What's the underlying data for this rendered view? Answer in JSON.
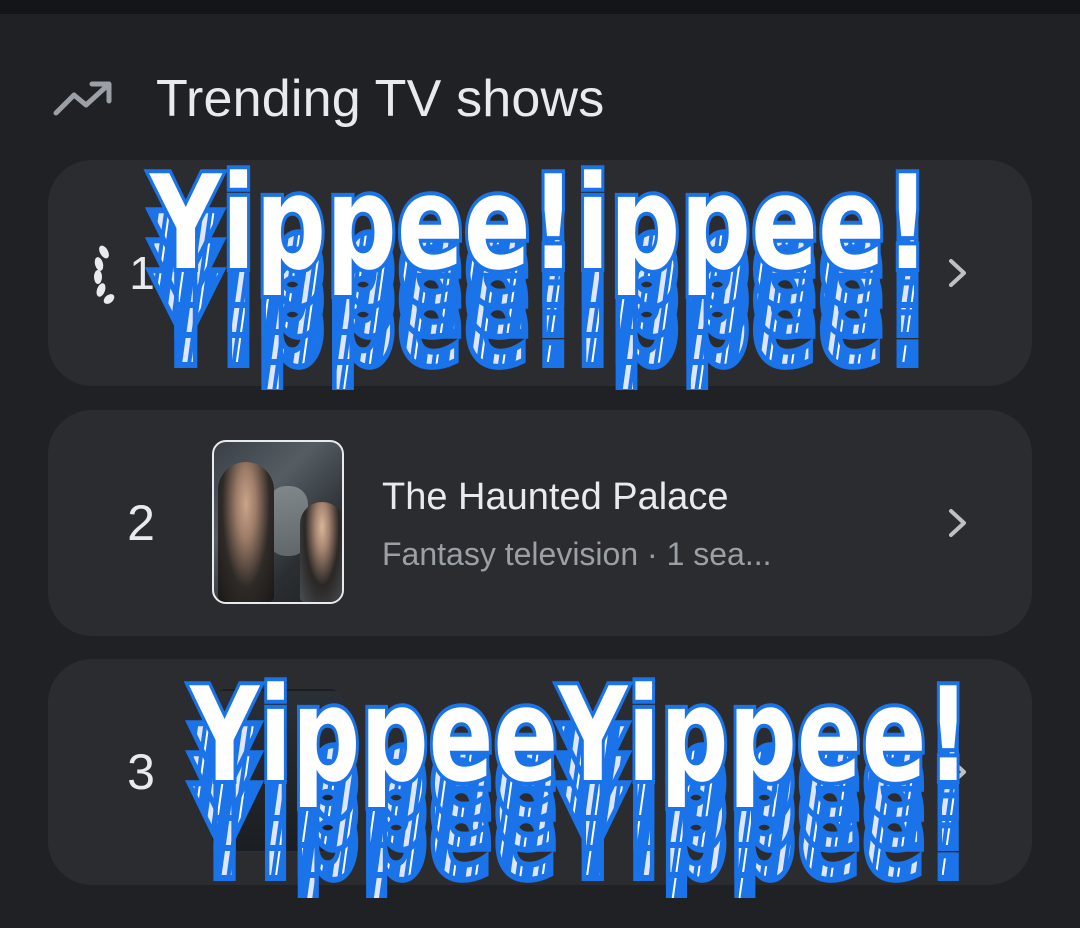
{
  "section": {
    "title": "Trending TV shows",
    "icon": "trending-up-icon"
  },
  "shows": [
    {
      "rank": "1",
      "rank_style": "laurel",
      "title": "",
      "subtitle": ""
    },
    {
      "rank": "2",
      "rank_style": "plain",
      "title": "The Haunted Palace",
      "subtitle": "Fantasy television · 1 sea..."
    },
    {
      "rank": "3",
      "rank_style": "plain",
      "title": "",
      "subtitle": ""
    }
  ],
  "overlay": {
    "sticker_top": "Yippee!ippee!",
    "sticker_bottom": "YippeeYippee!"
  },
  "colors": {
    "background": "#202124",
    "card": "#2b2c2f",
    "text_primary": "#e8eaed",
    "text_secondary": "#9aa0a6",
    "sticker_blue": "#1a73e8",
    "sticker_light": "#dfe6ff"
  }
}
